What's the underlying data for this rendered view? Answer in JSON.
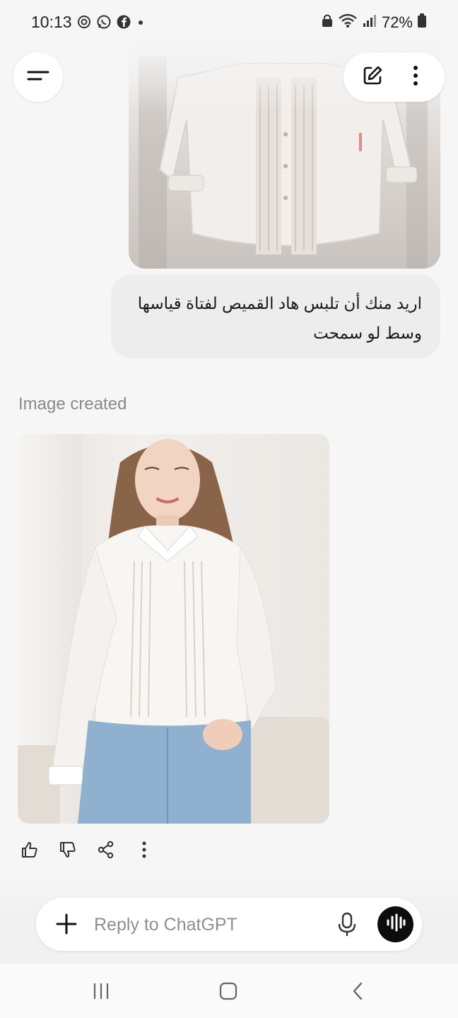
{
  "status_bar": {
    "time": "10:13",
    "battery_percent": "72%",
    "left_icons": [
      "openai-icon",
      "whatsapp-icon",
      "facebook-icon",
      "dot-icon"
    ],
    "right_icons": [
      "vpn-lock-icon",
      "wifi-icon",
      "signal-icon",
      "battery-icon"
    ]
  },
  "top_bar": {
    "menu_icon": "menu-icon",
    "new_chat_icon": "compose-icon",
    "more_icon": "more-vertical-icon"
  },
  "conversation": {
    "user_image_alt": "white ruffled blouse on hanger",
    "user_message": "اريد منك أن تلبس هاد القميص لفتاة قياسها وسط لو سمحت",
    "assistant_label": "Image created",
    "generated_image_alt": "woman wearing white ruffled blouse and jeans",
    "actions": [
      "thumbs-up-icon",
      "thumbs-down-icon",
      "share-icon",
      "more-vertical-icon"
    ]
  },
  "composer": {
    "placeholder": "Reply to ChatGPT",
    "value": "",
    "add_icon": "plus-icon",
    "mic_icon": "mic-icon",
    "voice_icon": "voice-mode-icon"
  },
  "nav_bar": {
    "buttons": [
      "recents-icon",
      "home-icon",
      "back-icon"
    ]
  },
  "colors": {
    "background": "#f6f6f6",
    "bubble": "#ededed",
    "label": "#8a8a8a",
    "voice_button": "#0d0d0d"
  }
}
